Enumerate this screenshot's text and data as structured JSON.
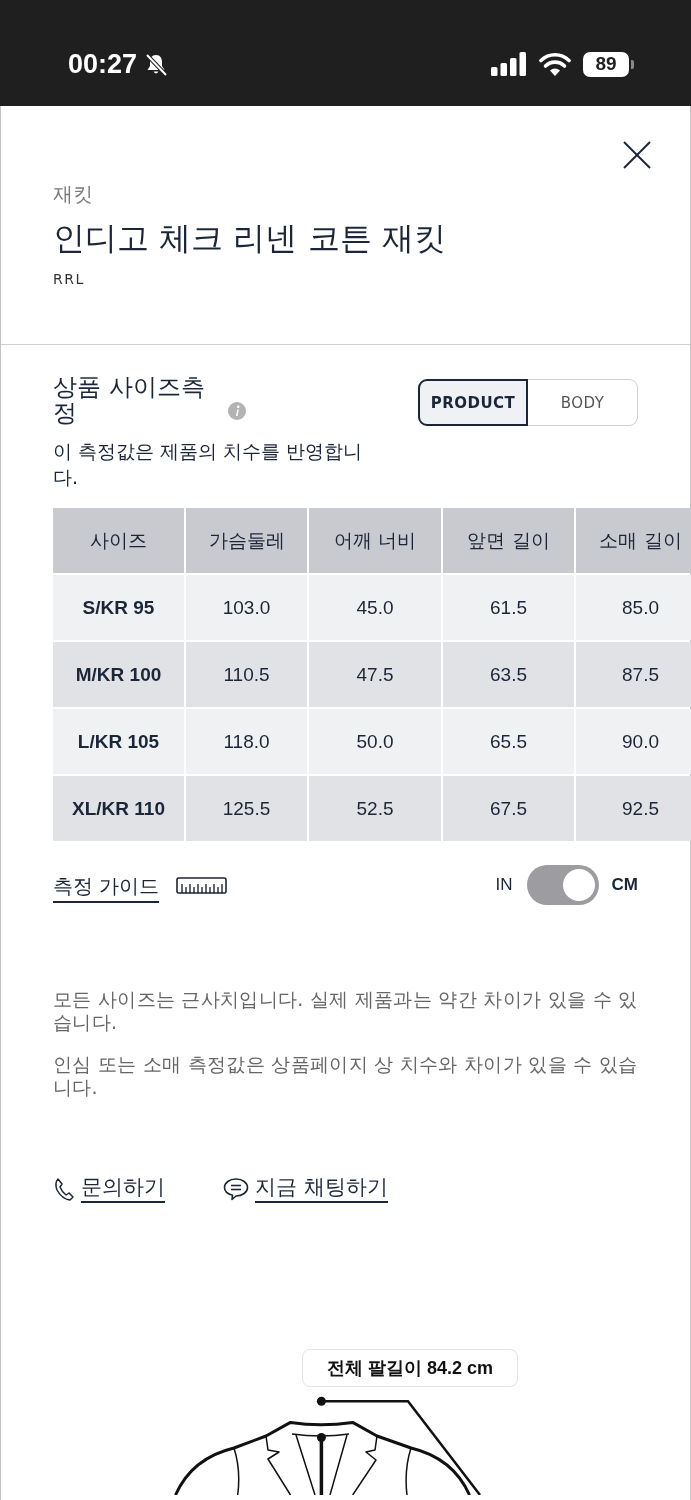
{
  "status_bar": {
    "time": "00:27",
    "battery": "89"
  },
  "header": {
    "category": "재킷",
    "title": "인디고 체크 리넨 코튼 재킷",
    "brand": "RRL"
  },
  "size_section": {
    "title": "상품 사이즈측정",
    "view_tabs": [
      {
        "label": "PRODUCT",
        "selected": true
      },
      {
        "label": "BODY",
        "selected": false
      }
    ],
    "description": "이 측정값은 제품의 치수를 반영합니다."
  },
  "table": {
    "columns": [
      "사이즈",
      "가슴둘레",
      "어깨 너비",
      "앞면 길이",
      "소매 길이"
    ],
    "rows": [
      [
        "S/KR 95",
        "103.0",
        "45.0",
        "61.5",
        "85.0"
      ],
      [
        "M/KR 100",
        "110.5",
        "47.5",
        "63.5",
        "87.5"
      ],
      [
        "L/KR 105",
        "118.0",
        "50.0",
        "65.5",
        "90.0"
      ],
      [
        "XL/KR 110",
        "125.5",
        "52.5",
        "67.5",
        "92.5"
      ]
    ]
  },
  "measure_guide": {
    "label": "측정 가이드"
  },
  "unit_toggle": {
    "off_label": "IN",
    "on_label": "CM",
    "on": true
  },
  "notes": [
    "모든 사이즈는 근사치입니다. 실제 제품과는 약간 차이가 있을 수 있습니다.",
    "인심 또는 소매 측정값은 상품페이지 상 치수와 차이가 있을 수 있습니다."
  ],
  "contact_links": [
    {
      "kind": "phone",
      "label": "문의하기"
    },
    {
      "kind": "chat",
      "label": "지금 채팅하기"
    }
  ],
  "illustration": {
    "label": "전체 팔길이 84.2 cm"
  }
}
